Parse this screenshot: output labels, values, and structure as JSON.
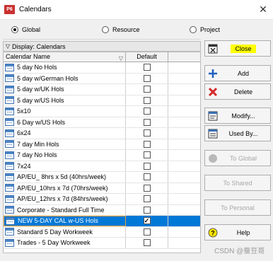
{
  "window": {
    "app_icon": "P6",
    "title": "Calendars",
    "close_glyph": "✕"
  },
  "scope": {
    "options": [
      {
        "label": "Global",
        "selected": true
      },
      {
        "label": "Resource",
        "selected": false
      },
      {
        "label": "Project",
        "selected": false
      }
    ]
  },
  "display_bar": {
    "label": "Display: Calendars"
  },
  "grid": {
    "columns": {
      "name": "Calendar Name",
      "default": "Default"
    },
    "rows": [
      {
        "name": "5 day No Hols",
        "default": false,
        "selected": false
      },
      {
        "name": "5 day w/German Hols",
        "default": false,
        "selected": false
      },
      {
        "name": "5 day w/UK Hols",
        "default": false,
        "selected": false
      },
      {
        "name": "5 day w/US Hols",
        "default": false,
        "selected": false
      },
      {
        "name": "5x10",
        "default": false,
        "selected": false
      },
      {
        "name": "6 Day w/US Hols",
        "default": false,
        "selected": false
      },
      {
        "name": "6x24",
        "default": false,
        "selected": false
      },
      {
        "name": "7 day Min Hols",
        "default": false,
        "selected": false
      },
      {
        "name": "7 day No Hols",
        "default": false,
        "selected": false
      },
      {
        "name": "7x24",
        "default": false,
        "selected": false
      },
      {
        "name": "AP/EU_ 8hrs x 5d (40hrs/week)",
        "default": false,
        "selected": false
      },
      {
        "name": "AP/EU_10hrs x 7d (70hrs/week)",
        "default": false,
        "selected": false
      },
      {
        "name": "AP/EU_12hrs x 7d (84hrs/week)",
        "default": false,
        "selected": false
      },
      {
        "name": "Corporate - Standard Full Time",
        "default": false,
        "selected": false
      },
      {
        "name": "NEW 5-DAY CAL w-US Hols",
        "default": true,
        "selected": true
      },
      {
        "name": "Standard 5 Day Workweek",
        "default": false,
        "selected": false
      },
      {
        "name": "Trades -  5 Day Workweek",
        "default": false,
        "selected": false
      }
    ]
  },
  "buttons": [
    {
      "id": "close",
      "label": "Close",
      "icon": "close-window-icon",
      "disabled": false
    },
    {
      "id": "add",
      "label": "Add",
      "icon": "add-plus-icon",
      "disabled": false
    },
    {
      "id": "delete",
      "label": "Delete",
      "icon": "delete-x-icon",
      "disabled": false
    },
    {
      "id": "modify",
      "label": "Modify...",
      "icon": "modify-window-icon",
      "disabled": false
    },
    {
      "id": "used-by",
      "label": "Used By...",
      "icon": "used-by-window-icon",
      "disabled": false
    },
    {
      "id": "to-global",
      "label": "To Global",
      "icon": "globe-icon",
      "disabled": true
    },
    {
      "id": "to-shared",
      "label": "To Shared",
      "icon": "",
      "disabled": true
    },
    {
      "id": "to-personal",
      "label": "To Personal",
      "icon": "",
      "disabled": true
    },
    {
      "id": "help",
      "label": "Help",
      "icon": "help-question-icon",
      "disabled": false
    }
  ],
  "watermark": "CSDN @蚕豆哥",
  "colors": {
    "selection": "#0078d7",
    "highlight": "#ffff00",
    "delete_red": "#d62a2a",
    "add_blue": "#1f5fbf"
  }
}
